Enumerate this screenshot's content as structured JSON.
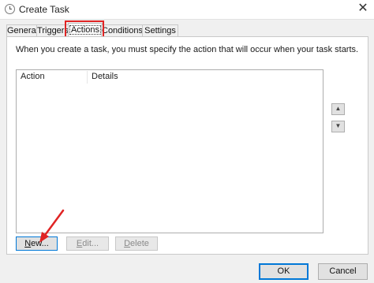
{
  "window": {
    "title": "Create Task",
    "close_glyph": "✕"
  },
  "tabs": [
    {
      "label": "General"
    },
    {
      "label": "Triggers"
    },
    {
      "label": "Actions",
      "active": true
    },
    {
      "label": "Conditions"
    },
    {
      "label": "Settings"
    }
  ],
  "actions_tab": {
    "instruction": "When you create a task, you must specify the action that will occur when your task starts.",
    "columns": [
      "Action",
      "Details"
    ],
    "rows": [],
    "move_up_icon": "triangle-up-icon",
    "move_down_icon": "triangle-down-icon",
    "move_up_glyph": "▲",
    "move_down_glyph": "▼",
    "buttons": {
      "new": {
        "mnemonic": "N",
        "rest": "ew..."
      },
      "edit": {
        "mnemonic": "E",
        "rest": "dit..."
      },
      "delete": {
        "mnemonic": "D",
        "rest": "elete"
      }
    }
  },
  "dialog_buttons": {
    "ok": "OK",
    "cancel": "Cancel"
  },
  "annotation": {
    "highlight_color": "#e02424",
    "arrow_color": "#e02424"
  }
}
